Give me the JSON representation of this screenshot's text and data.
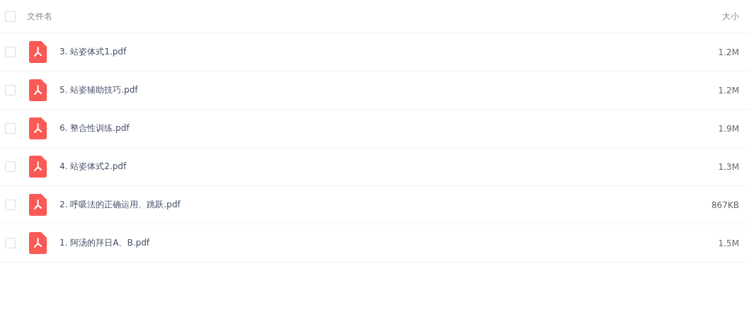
{
  "header": {
    "checked": false,
    "name_label": "文件名",
    "size_label": "大小"
  },
  "files": [
    {
      "name": "3. 站姿体式1.pdf",
      "size": "1.2M",
      "checked": false
    },
    {
      "name": "5. 站姿辅助技巧.pdf",
      "size": "1.2M",
      "checked": false
    },
    {
      "name": "6. 整合性训练.pdf",
      "size": "1.9M",
      "checked": false
    },
    {
      "name": "4. 站姿体式2.pdf",
      "size": "1.3M",
      "checked": false
    },
    {
      "name": "2. 呼吸法的正确运用、跳跃.pdf",
      "size": "867KB",
      "checked": false
    },
    {
      "name": "1. 阿汤的拜日A、B.pdf",
      "size": "1.5M",
      "checked": false
    }
  ]
}
